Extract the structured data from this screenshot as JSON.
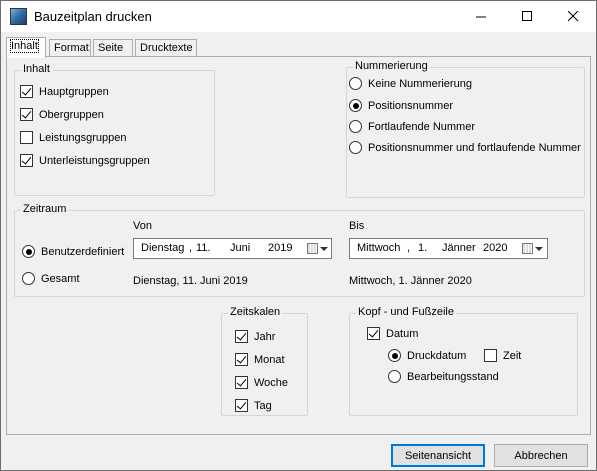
{
  "window": {
    "title": "Bauzeitplan drucken",
    "minimize_symbol": "—",
    "maximize_symbol": "□",
    "close_symbol": "✕"
  },
  "tabs": [
    {
      "label": "Inhalt",
      "active": true
    },
    {
      "label": "Format",
      "active": false
    },
    {
      "label": "Seite",
      "active": false
    },
    {
      "label": "Drucktexte",
      "active": false
    }
  ],
  "inhalt": {
    "legend": "Inhalt",
    "items": [
      {
        "label": "Hauptgruppen",
        "checked": true
      },
      {
        "label": "Obergruppen",
        "checked": true
      },
      {
        "label": "Leistungsgruppen",
        "checked": false
      },
      {
        "label": "Unterleistungsgruppen",
        "checked": true
      }
    ]
  },
  "nummerierung": {
    "legend": "Nummerierung",
    "options": [
      {
        "label": "Keine Nummerierung",
        "selected": false
      },
      {
        "label": "Positionsnummer",
        "selected": true
      },
      {
        "label": "Fortlaufende Nummer",
        "selected": false
      },
      {
        "label": "Positionsnummer und fortlaufende Nummer",
        "selected": false
      }
    ]
  },
  "zeitraum": {
    "legend": "Zeitraum",
    "von_label": "Von",
    "bis_label": "Bis",
    "option_custom": "Benutzerdefiniert",
    "option_total": "Gesamt",
    "custom_selected": true,
    "von_date": {
      "weekday": "Dienstag",
      "sep1": ",",
      "day": "11.",
      "month": "Juni",
      "year": "2019"
    },
    "bis_date": {
      "weekday": "Mittwoch",
      "sep1": ",",
      "day": "1.",
      "month": "Jänner",
      "year": "2020"
    },
    "gesamt_von": "Dienstag, 11. Juni 2019",
    "gesamt_bis": "Mittwoch, 1. Jänner 2020"
  },
  "zeitskalen": {
    "legend": "Zeitskalen",
    "items": [
      {
        "label": "Jahr",
        "checked": true
      },
      {
        "label": "Monat",
        "checked": true
      },
      {
        "label": "Woche",
        "checked": true
      },
      {
        "label": "Tag",
        "checked": true
      }
    ]
  },
  "kopf": {
    "legend": "Kopf - und Fußzeile",
    "datum_label": "Datum",
    "datum_checked": true,
    "druckdatum_label": "Druckdatum",
    "druckdatum_selected": true,
    "zeit_label": "Zeit",
    "zeit_checked": false,
    "bearbeitung_label": "Bearbeitungsstand",
    "bearbeitung_selected": false
  },
  "buttons": {
    "preview": "Seitenansicht",
    "cancel": "Abbrechen"
  }
}
